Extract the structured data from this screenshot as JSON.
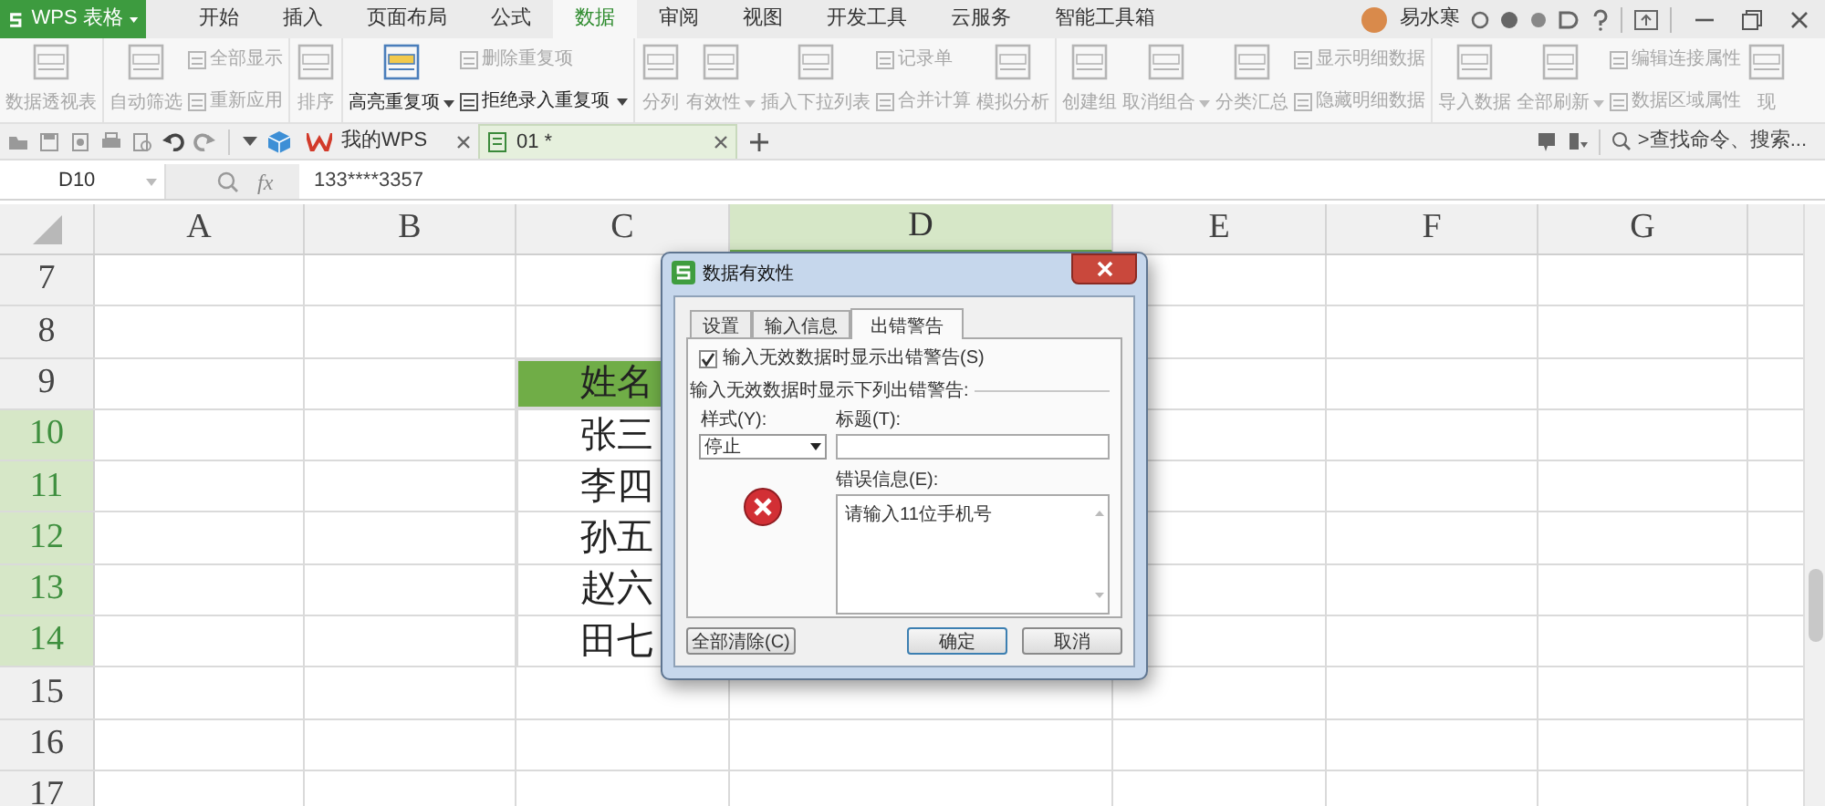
{
  "app": {
    "name": "WPS 表格"
  },
  "menu_tabs": [
    {
      "label": "开始",
      "selected": false
    },
    {
      "label": "插入",
      "selected": false
    },
    {
      "label": "页面布局",
      "selected": false
    },
    {
      "label": "公式",
      "selected": false
    },
    {
      "label": "数据",
      "selected": true
    },
    {
      "label": "审阅",
      "selected": false
    },
    {
      "label": "视图",
      "selected": false
    },
    {
      "label": "开发工具",
      "selected": false
    },
    {
      "label": "云服务",
      "selected": false
    },
    {
      "label": "智能工具箱",
      "selected": false
    }
  ],
  "user": {
    "name": "易水寒"
  },
  "ribbon": [
    [
      {
        "kind": "large",
        "label": "数据透视表",
        "disabled": true,
        "dropdown": false
      }
    ],
    [
      {
        "kind": "large",
        "label": "自动筛选",
        "disabled": true,
        "dropdown": false
      },
      {
        "kind": "stack",
        "items": [
          {
            "label": "全部显示",
            "disabled": true,
            "dropdown": false
          },
          {
            "label": "重新应用",
            "disabled": true,
            "dropdown": false
          }
        ]
      }
    ],
    [
      {
        "kind": "large",
        "label": "排序",
        "disabled": true,
        "dropdown": false
      }
    ],
    [
      {
        "kind": "large",
        "label": "高亮重复项",
        "disabled": false,
        "dropdown": true
      },
      {
        "kind": "stack",
        "items": [
          {
            "label": "删除重复项",
            "disabled": true,
            "dropdown": false
          },
          {
            "label": "拒绝录入重复项",
            "disabled": false,
            "dropdown": true
          }
        ]
      }
    ],
    [
      {
        "kind": "large",
        "label": "分列",
        "disabled": true,
        "dropdown": false
      },
      {
        "kind": "large",
        "label": "有效性",
        "disabled": true,
        "dropdown": true
      },
      {
        "kind": "large",
        "label": "插入下拉列表",
        "disabled": true,
        "dropdown": false
      },
      {
        "kind": "stack",
        "items": [
          {
            "label": "记录单",
            "disabled": true,
            "dropdown": false
          },
          {
            "label": "合并计算",
            "disabled": true,
            "dropdown": false
          }
        ]
      },
      {
        "kind": "large",
        "label": "模拟分析",
        "disabled": true,
        "dropdown": false
      }
    ],
    [
      {
        "kind": "large",
        "label": "创建组",
        "disabled": true,
        "dropdown": false
      },
      {
        "kind": "large",
        "label": "取消组合",
        "disabled": true,
        "dropdown": true
      },
      {
        "kind": "large",
        "label": "分类汇总",
        "disabled": true,
        "dropdown": false
      },
      {
        "kind": "stack",
        "items": [
          {
            "label": "显示明细数据",
            "disabled": true,
            "dropdown": false
          },
          {
            "label": "隐藏明细数据",
            "disabled": true,
            "dropdown": false
          }
        ]
      }
    ],
    [
      {
        "kind": "large",
        "label": "导入数据",
        "disabled": true,
        "dropdown": false
      },
      {
        "kind": "large",
        "label": "全部刷新",
        "disabled": true,
        "dropdown": true
      },
      {
        "kind": "stack",
        "items": [
          {
            "label": "编辑连接属性",
            "disabled": true,
            "dropdown": false
          },
          {
            "label": "数据区域属性",
            "disabled": true,
            "dropdown": false
          }
        ]
      },
      {
        "kind": "large",
        "label": "现",
        "disabled": true,
        "dropdown": false
      }
    ]
  ],
  "doc_tabs": [
    {
      "label": "我的WPS",
      "selected": false,
      "kind": "home"
    },
    {
      "label": "01 *",
      "selected": true,
      "kind": "sheet"
    }
  ],
  "command_search": {
    "placeholder": ">查找命令、搜索..."
  },
  "formula_bar": {
    "name_box": "D10",
    "fx_label": "fx",
    "formula": "133****3357"
  },
  "sheet": {
    "columns": [
      {
        "label": "A",
        "selected": false
      },
      {
        "label": "B",
        "selected": false
      },
      {
        "label": "C",
        "selected": false
      },
      {
        "label": "D",
        "selected": true
      },
      {
        "label": "E",
        "selected": false
      },
      {
        "label": "F",
        "selected": false
      },
      {
        "label": "G",
        "selected": false
      }
    ],
    "rows": [
      {
        "label": "7",
        "selected": false
      },
      {
        "label": "8",
        "selected": false
      },
      {
        "label": "9",
        "selected": false,
        "col_c": {
          "text": "姓名",
          "kind": "header"
        }
      },
      {
        "label": "10",
        "selected": true,
        "col_c": {
          "text": "张三",
          "kind": "data"
        }
      },
      {
        "label": "11",
        "selected": true,
        "col_c": {
          "text": "李四",
          "kind": "data"
        }
      },
      {
        "label": "12",
        "selected": true,
        "col_c": {
          "text": "孙五",
          "kind": "data"
        }
      },
      {
        "label": "13",
        "selected": true,
        "col_c": {
          "text": "赵六",
          "kind": "data"
        }
      },
      {
        "label": "14",
        "selected": true,
        "col_c": {
          "text": "田七",
          "kind": "data"
        }
      },
      {
        "label": "15",
        "selected": false
      },
      {
        "label": "16",
        "selected": false
      },
      {
        "label": "17",
        "selected": false
      }
    ]
  },
  "dialog": {
    "title": "数据有效性",
    "tabs": [
      {
        "label": "设置",
        "selected": false
      },
      {
        "label": "输入信息",
        "selected": false
      },
      {
        "label": "出错警告",
        "selected": true
      }
    ],
    "show_alert": {
      "label": "输入无效数据时显示出错警告(S)",
      "checked": true
    },
    "section_label": "输入无效数据时显示下列出错警告:",
    "style_label": "样式(Y):",
    "style_value": "停止",
    "title_label": "标题(T):",
    "message_label": "错误信息(E):",
    "message": "请输入11位手机号",
    "buttons": [
      {
        "label": "全部清除(C)",
        "kind": "clear"
      },
      {
        "label": "确定",
        "kind": "ok"
      },
      {
        "label": "取消",
        "kind": "cancel"
      }
    ]
  }
}
